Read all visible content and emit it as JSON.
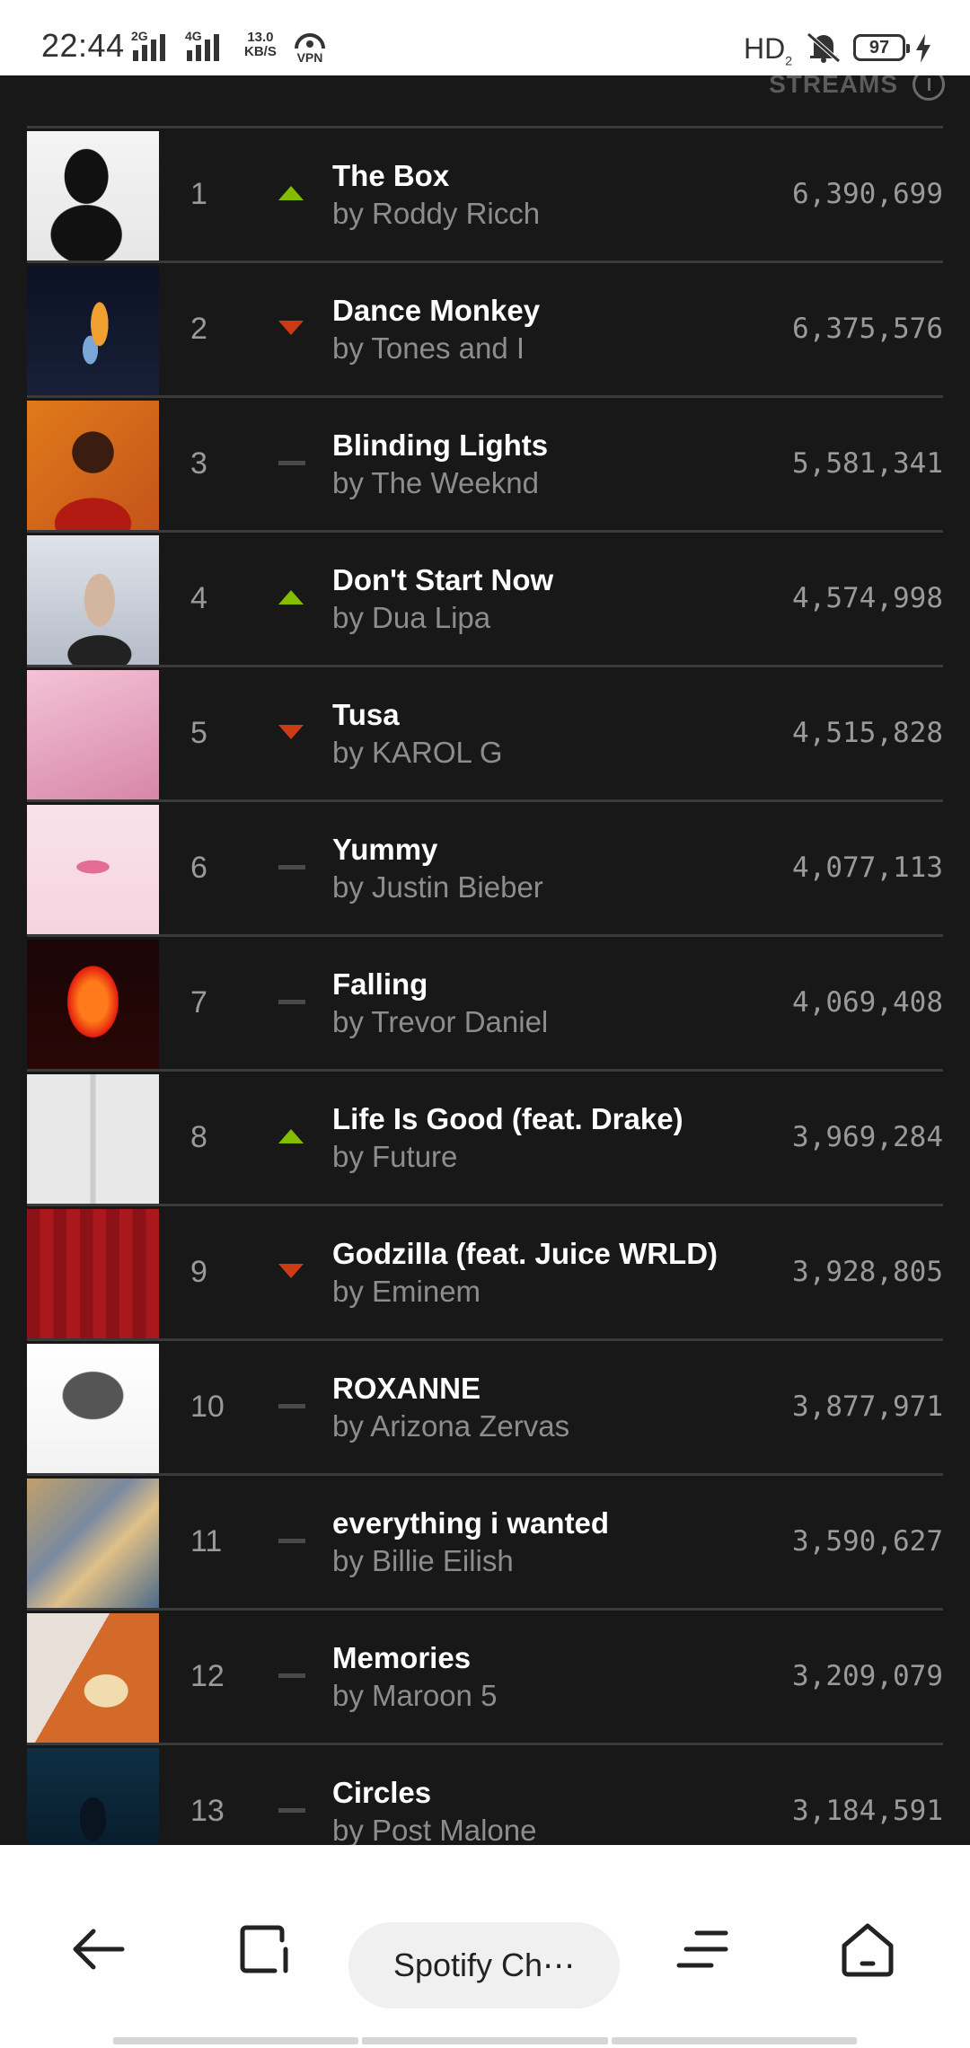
{
  "status_bar": {
    "time": "22:44",
    "net1": "2G",
    "net2": "4G",
    "speed_value": "13.0",
    "speed_unit": "KB/S",
    "vpn": "VPN",
    "hd": "HD",
    "hd_sub": "2",
    "battery": "97"
  },
  "chart": {
    "column_header": "STREAMS",
    "rows": [
      {
        "rank": "1",
        "trend": "up",
        "title": "The Box",
        "artist": "by Roddy Ricch",
        "streams": "6,390,699"
      },
      {
        "rank": "2",
        "trend": "down",
        "title": "Dance Monkey",
        "artist": "by Tones and I",
        "streams": "6,375,576"
      },
      {
        "rank": "3",
        "trend": "same",
        "title": "Blinding Lights",
        "artist": "by The Weeknd",
        "streams": "5,581,341"
      },
      {
        "rank": "4",
        "trend": "up",
        "title": "Don't Start Now",
        "artist": "by Dua Lipa",
        "streams": "4,574,998"
      },
      {
        "rank": "5",
        "trend": "down",
        "title": "Tusa",
        "artist": "by KAROL G",
        "streams": "4,515,828"
      },
      {
        "rank": "6",
        "trend": "same",
        "title": "Yummy",
        "artist": "by Justin Bieber",
        "streams": "4,077,113"
      },
      {
        "rank": "7",
        "trend": "same",
        "title": "Falling",
        "artist": "by Trevor Daniel",
        "streams": "4,069,408"
      },
      {
        "rank": "8",
        "trend": "up",
        "title": "Life Is Good (feat. Drake)",
        "artist": "by Future",
        "streams": "3,969,284"
      },
      {
        "rank": "9",
        "trend": "down",
        "title": "Godzilla (feat. Juice WRLD)",
        "artist": "by Eminem",
        "streams": "3,928,805"
      },
      {
        "rank": "10",
        "trend": "same",
        "title": "ROXANNE",
        "artist": "by Arizona Zervas",
        "streams": "3,877,971"
      },
      {
        "rank": "11",
        "trend": "same",
        "title": "everything i wanted",
        "artist": "by Billie Eilish",
        "streams": "3,590,627"
      },
      {
        "rank": "12",
        "trend": "same",
        "title": "Memories",
        "artist": "by Maroon 5",
        "streams": "3,209,079"
      },
      {
        "rank": "13",
        "trend": "same",
        "title": "Circles",
        "artist": "by Post Malone",
        "streams": "3,184,591"
      }
    ],
    "colors": {
      "up": "#84bd00",
      "down": "#cd3a13",
      "same": "#4a4a4a"
    }
  },
  "browser_bar": {
    "tab_title": "Spotify Ch⋯",
    "icons": [
      "back-icon",
      "tabs-icon",
      "menu-icon",
      "home-icon"
    ]
  }
}
